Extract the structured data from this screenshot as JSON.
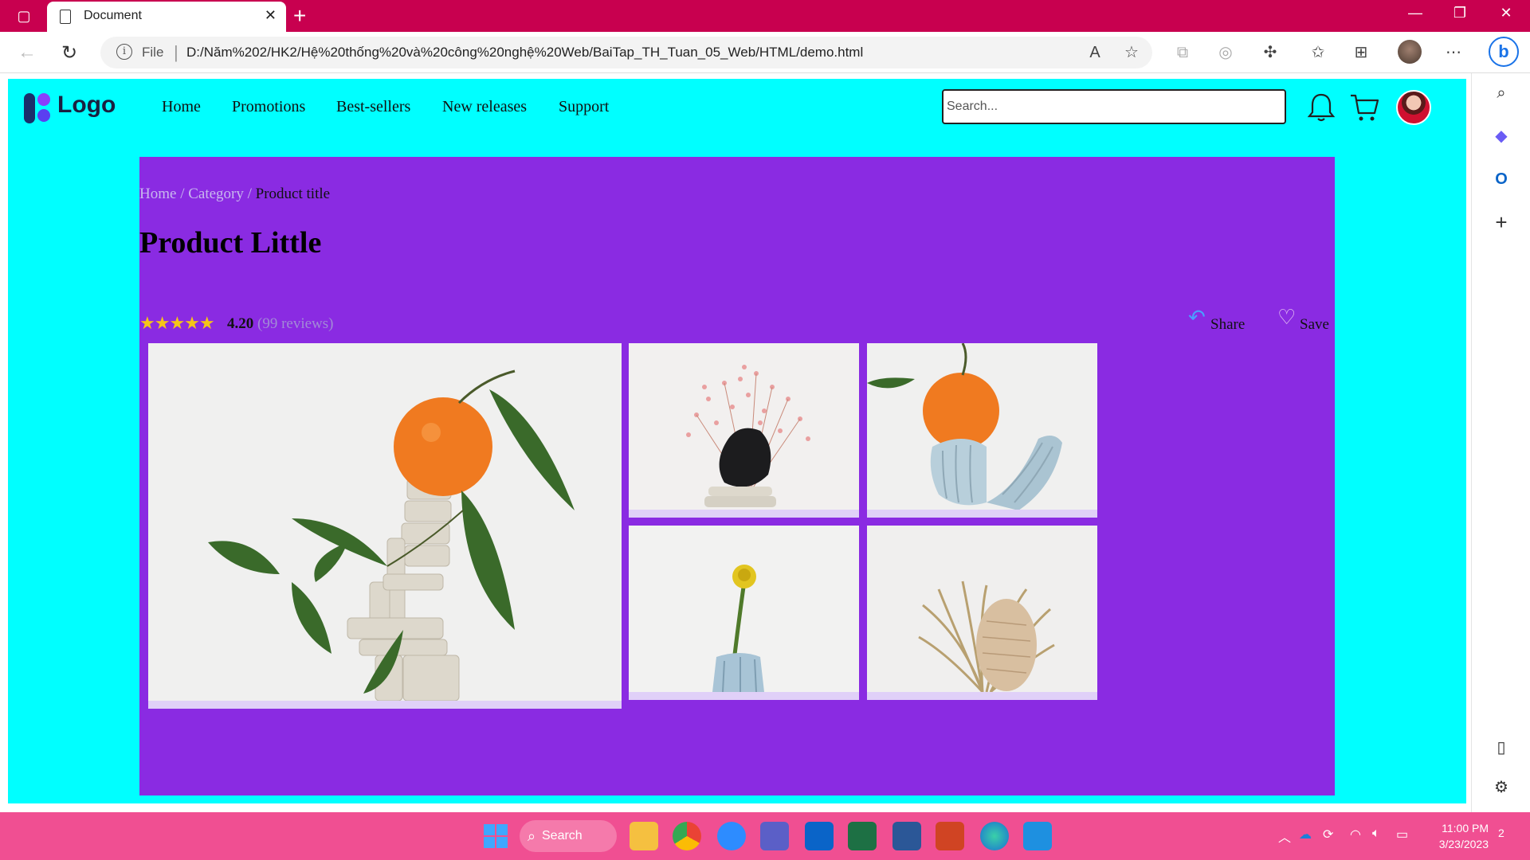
{
  "browser": {
    "tab_title": "Document",
    "url_scheme_label": "File",
    "url": "D:/Năm%202/HK2/Hệ%20thống%20và%20công%20nghệ%20Web/BaiTap_TH_Tuan_05_Web/HTML/demo.html"
  },
  "site": {
    "logo_text": "Logo",
    "nav": [
      "Home",
      "Promotions",
      "Best-sellers",
      "New releases",
      "Support"
    ],
    "search_placeholder": "Search..."
  },
  "product": {
    "breadcrumb": {
      "home": "Home",
      "sep1": " / ",
      "category": "Category",
      "sep2": " / ",
      "current": "Product title"
    },
    "title": "Product Little",
    "stars": "★★★★★",
    "rating": "4.20",
    "reviews": "(99 reviews)",
    "share_label": "Share",
    "save_label": "Save",
    "photos": [
      "orange-clay-stack",
      "pink-flowers-black-stone",
      "orange-blue-clay-u",
      "yellow-flower-vase",
      "dried-banksia"
    ]
  },
  "taskbar": {
    "search_label": "Search",
    "time": "11:00 PM",
    "date": "3/23/2023",
    "notification_count": "2"
  },
  "colors": {
    "titlebar": "#c8004f",
    "page_bg": "#00ffff",
    "product_bg": "#8a2be2",
    "taskbar": "#f04f92"
  }
}
